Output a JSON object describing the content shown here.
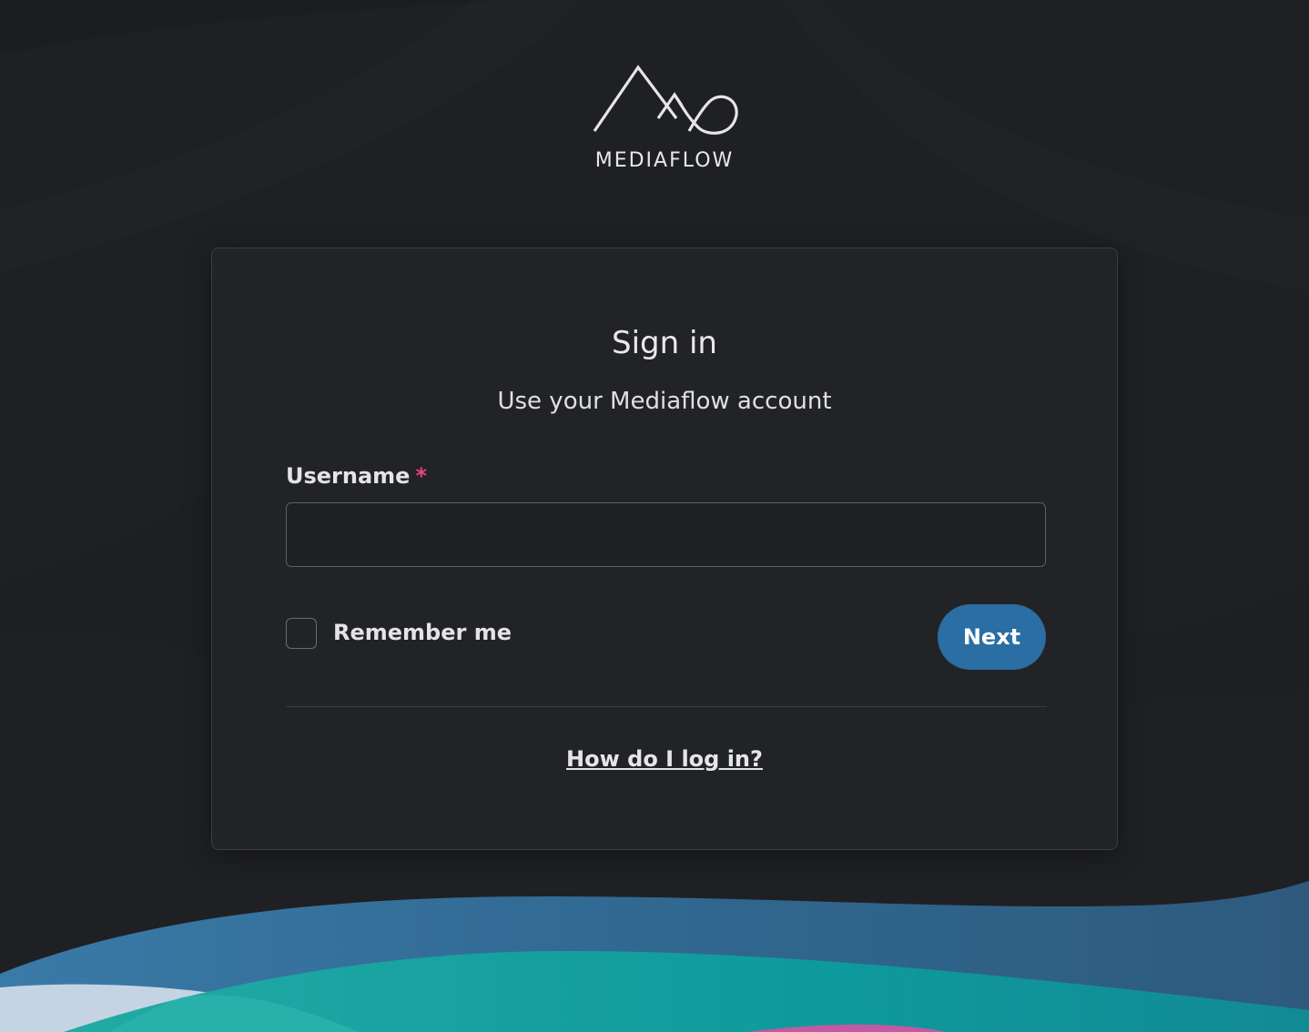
{
  "brand": {
    "name": "MEDIAFLOW"
  },
  "signin": {
    "title": "Sign in",
    "subtitle": "Use your Mediaflow account"
  },
  "username_field": {
    "label": "Username",
    "required_marker": "*",
    "value": "",
    "placeholder": ""
  },
  "remember": {
    "label": "Remember me",
    "checked": false
  },
  "next_button": {
    "label": "Next"
  },
  "help": {
    "link_text": "How do I log in?"
  },
  "colors": {
    "background": "#1f2024",
    "card": "#222327",
    "accent": "#2a6ea3",
    "required": "#e8457a",
    "wave_blue": "#2f6f98",
    "wave_teal": "#1a9ea0",
    "wave_light": "#c5d4e2",
    "wave_pink": "#c25aa0"
  },
  "icons": {
    "logo": "mountain-wave-logo-icon"
  }
}
